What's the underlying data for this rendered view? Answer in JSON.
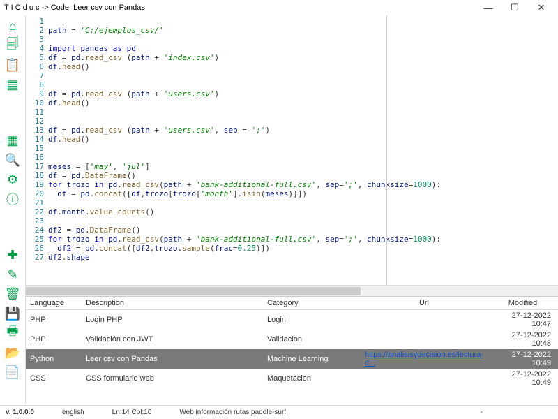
{
  "title": "T I C d o c  -> Code: Leer csv con Pandas",
  "window": {
    "min": "—",
    "max": "☐",
    "close": "✕"
  },
  "sidebar": [
    {
      "name": "home-icon",
      "glyph": "⌂"
    },
    {
      "name": "files-icon",
      "glyph": "🗐"
    },
    {
      "name": "clipboard-icon",
      "glyph": "📋"
    },
    {
      "name": "note-icon",
      "glyph": "▤"
    },
    {
      "name": "gap",
      "glyph": ""
    },
    {
      "name": "grid-icon",
      "glyph": "▦"
    },
    {
      "name": "search-icon",
      "glyph": "🔍"
    },
    {
      "name": "gear-icon",
      "glyph": "⚙"
    },
    {
      "name": "info-icon",
      "glyph": "ⓘ"
    },
    {
      "name": "gap",
      "glyph": ""
    },
    {
      "name": "add-icon",
      "glyph": "✚"
    },
    {
      "name": "edit-icon",
      "glyph": "✎"
    },
    {
      "name": "trash-icon",
      "glyph": "🗑"
    },
    {
      "name": "save-icon",
      "glyph": "💾"
    },
    {
      "name": "print-icon",
      "glyph": "🖶"
    },
    {
      "name": "open-icon",
      "glyph": "📂"
    },
    {
      "name": "export-icon",
      "glyph": "📄"
    }
  ],
  "code": {
    "lines": [
      {
        "n": 1,
        "h": ""
      },
      {
        "n": 2,
        "h": "<span class='v'>path</span> = <span class='s'>'C:/ejemplos_csv/'</span>"
      },
      {
        "n": 3,
        "h": ""
      },
      {
        "n": 4,
        "h": "<span class='k'>import</span> <span class='v'>pandas</span> <span class='k'>as</span> <span class='v'>pd</span>"
      },
      {
        "n": 5,
        "h": "<span class='v'>df</span> = <span class='v'>pd</span>.<span class='f'>read_csv</span> (<span class='v'>path</span> + <span class='s'>'index.csv'</span>)"
      },
      {
        "n": 6,
        "h": "<span class='v'>df</span>.<span class='f'>head</span>()"
      },
      {
        "n": 7,
        "h": ""
      },
      {
        "n": 8,
        "h": ""
      },
      {
        "n": 9,
        "h": "<span class='v'>df</span> = <span class='v'>pd</span>.<span class='f'>read_csv</span> (<span class='v'>path</span> + <span class='s'>'users.csv'</span>)"
      },
      {
        "n": 10,
        "h": "<span class='v'>df</span>.<span class='f'>head</span>()"
      },
      {
        "n": 11,
        "h": ""
      },
      {
        "n": 12,
        "h": ""
      },
      {
        "n": 13,
        "h": "<span class='v'>df</span> = <span class='v'>pd</span>.<span class='f'>read_csv</span> (<span class='v'>path</span> + <span class='s'>'users.csv'</span>, <span class='v'>sep</span> = <span class='s'>';'</span>)"
      },
      {
        "n": 14,
        "h": "<span class='v'>df</span>.<span class='f'>head</span>()"
      },
      {
        "n": 15,
        "h": ""
      },
      {
        "n": 16,
        "h": ""
      },
      {
        "n": 17,
        "h": "<span class='v'>meses</span> = [<span class='s'>'may'</span>, <span class='s'>'jul'</span>]"
      },
      {
        "n": 18,
        "h": "<span class='v'>df</span> = <span class='v'>pd</span>.<span class='f'>DataFrame</span>()"
      },
      {
        "n": 19,
        "h": "<span class='k'>for</span> <span class='v'>trozo</span> <span class='k'>in</span> <span class='v'>pd</span>.<span class='f'>read_csv</span>(<span class='v'>path</span> + <span class='s'>'bank-additional-full.csv'</span>, <span class='v'>sep</span>=<span class='s'>';'</span>, <span class='v'>chunksize</span>=<span class='n'>1000</span>):"
      },
      {
        "n": 20,
        "h": "  <span class='v'>df</span> = <span class='v'>pd</span>.<span class='f'>concat</span>([<span class='v'>df</span>,<span class='v'>trozo</span>[<span class='v'>trozo</span>[<span class='s'>'month'</span>].<span class='f'>isin</span>(<span class='v'>meses</span>)]])"
      },
      {
        "n": 21,
        "h": ""
      },
      {
        "n": 22,
        "h": "<span class='v'>df</span>.<span class='v'>month</span>.<span class='f'>value_counts</span>()"
      },
      {
        "n": 23,
        "h": ""
      },
      {
        "n": 24,
        "h": "<span class='v'>df2</span> = <span class='v'>pd</span>.<span class='f'>DataFrame</span>()"
      },
      {
        "n": 25,
        "h": "<span class='k'>for</span> <span class='v'>trozo</span> <span class='k'>in</span> <span class='v'>pd</span>.<span class='f'>read_csv</span>(<span class='v'>path</span> + <span class='s'>'bank-additional-full.csv'</span>, <span class='v'>sep</span>=<span class='s'>';'</span>, <span class='v'>chunksize</span>=<span class='n'>1000</span>):"
      },
      {
        "n": 26,
        "h": "  <span class='v'>df2</span> = <span class='v'>pd</span>.<span class='f'>concat</span>([<span class='v'>df2</span>,<span class='v'>trozo</span>.<span class='f'>sample</span>(<span class='v'>frac</span>=<span class='n'>0.25</span>)])"
      },
      {
        "n": 27,
        "h": "<span class='v'>df2</span>.<span class='v'>shape</span>"
      }
    ]
  },
  "table": {
    "headers": {
      "lang": "Language",
      "desc": "Description",
      "cat": "Category",
      "url": "Url",
      "mod": "Modified"
    },
    "rows": [
      {
        "lang": "PHP",
        "desc": "Login PHP",
        "cat": "Login",
        "url": "",
        "mod": "27-12-2022 10:47",
        "sel": false
      },
      {
        "lang": "PHP",
        "desc": "Validación con JWT",
        "cat": "Validacion",
        "url": "",
        "mod": "27-12-2022 10:48",
        "sel": false
      },
      {
        "lang": "Python",
        "desc": "Leer csv con Pandas",
        "cat": "Machine Learning",
        "url": "https://analisisydecision.es/lectura-d...",
        "mod": "27-12-2022 10:49",
        "sel": true
      },
      {
        "lang": "CSS",
        "desc": "CSS formulario web",
        "cat": "Maquetacion",
        "url": "",
        "mod": "27-12-2022 10:49",
        "sel": false
      }
    ]
  },
  "status": {
    "version": "v.  1.0.0.0",
    "lang": "english",
    "pos": "Ln:14 Col:10",
    "info": "Web información rutas paddle-surf",
    "dash": "-"
  }
}
